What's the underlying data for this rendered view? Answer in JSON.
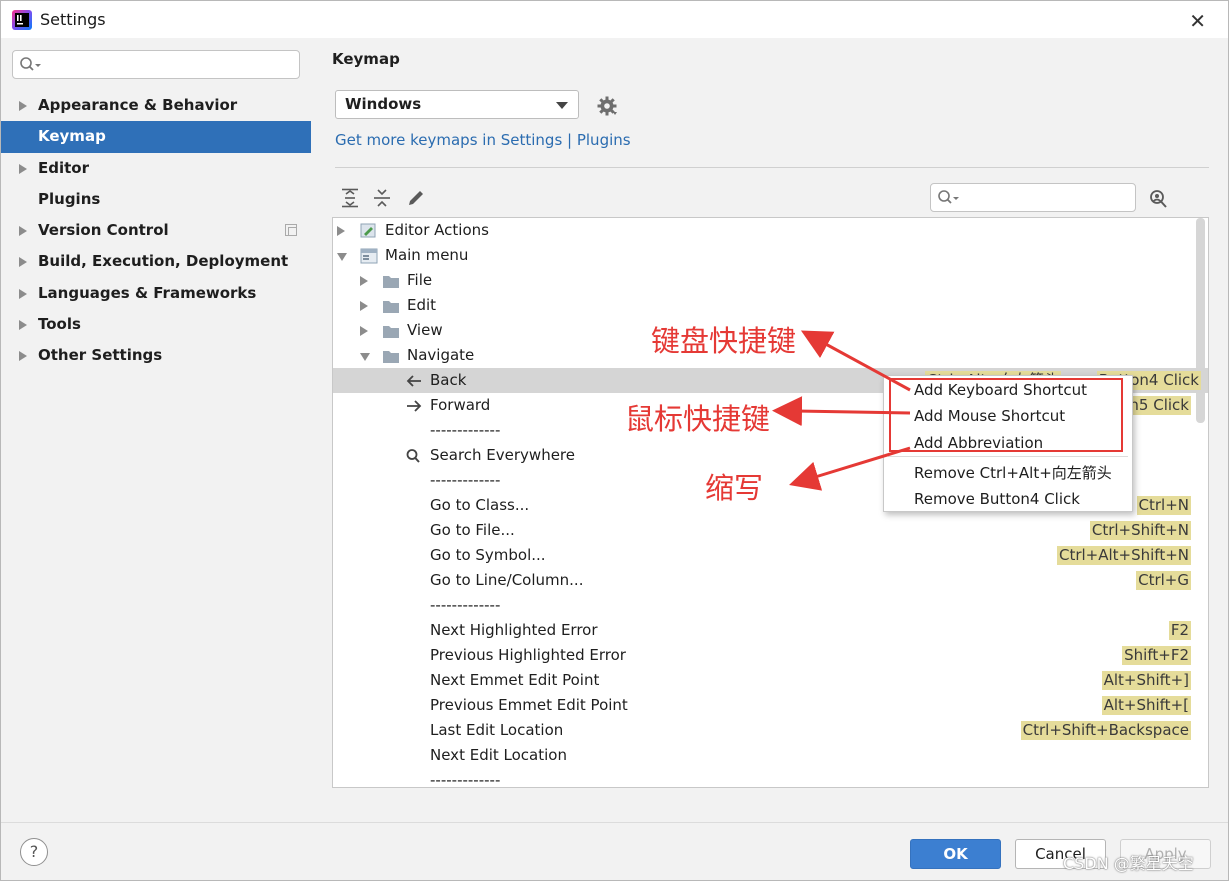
{
  "window": {
    "title": "Settings",
    "close_glyph": "✕"
  },
  "sidebar": {
    "search_placeholder": "",
    "items": [
      {
        "label": "Appearance & Behavior",
        "expandable": true
      },
      {
        "label": "Keymap",
        "expandable": false,
        "selected": true
      },
      {
        "label": "Editor",
        "expandable": true
      },
      {
        "label": "Plugins",
        "expandable": false
      },
      {
        "label": "Version Control",
        "expandable": true
      },
      {
        "label": "Build, Execution, Deployment",
        "expandable": true
      },
      {
        "label": "Languages & Frameworks",
        "expandable": true
      },
      {
        "label": "Tools",
        "expandable": true
      },
      {
        "label": "Other Settings",
        "expandable": true
      }
    ]
  },
  "main": {
    "title": "Keymap",
    "keymap_value": "Windows",
    "more_keymaps_link": "Get more keymaps in Settings | Plugins",
    "filter_placeholder": ""
  },
  "tree": [
    {
      "label": "Editor Actions",
      "indent": 0,
      "toggle": "right",
      "icon": "editor-actions-icon"
    },
    {
      "label": "Main menu",
      "indent": 0,
      "toggle": "down",
      "icon": "main-menu-icon"
    },
    {
      "label": "File",
      "indent": 1,
      "toggle": "right",
      "icon": "folder-icon"
    },
    {
      "label": "Edit",
      "indent": 1,
      "toggle": "right",
      "icon": "folder-icon"
    },
    {
      "label": "View",
      "indent": 1,
      "toggle": "right",
      "icon": "folder-icon"
    },
    {
      "label": "Navigate",
      "indent": 1,
      "toggle": "down",
      "icon": "folder-icon"
    },
    {
      "label": "Back",
      "indent": 2,
      "icon": "arrow-left-icon",
      "selected": true,
      "shortcuts": [
        "Ctrl+Alt+向左箭头",
        "Button4 Click"
      ]
    },
    {
      "label": "Forward",
      "indent": 2,
      "icon": "arrow-right-icon",
      "shortcuts": [
        "Button5 Click"
      ]
    },
    {
      "label": "-------------",
      "indent": 2
    },
    {
      "label": "Search Everywhere",
      "indent": 2,
      "icon": "search-icon"
    },
    {
      "label": "-------------",
      "indent": 2
    },
    {
      "label": "Go to Class...",
      "indent": 2,
      "shortcuts": [
        "Ctrl+N"
      ]
    },
    {
      "label": "Go to File...",
      "indent": 2,
      "shortcuts": [
        "Ctrl+Shift+N"
      ]
    },
    {
      "label": "Go to Symbol...",
      "indent": 2,
      "shortcuts": [
        "Ctrl+Alt+Shift+N"
      ]
    },
    {
      "label": "Go to Line/Column...",
      "indent": 2,
      "shortcuts": [
        "Ctrl+G"
      ]
    },
    {
      "label": "-------------",
      "indent": 2
    },
    {
      "label": "Next Highlighted Error",
      "indent": 2,
      "shortcuts": [
        "F2"
      ]
    },
    {
      "label": "Previous Highlighted Error",
      "indent": 2,
      "shortcuts": [
        "Shift+F2"
      ]
    },
    {
      "label": "Next Emmet Edit Point",
      "indent": 2,
      "shortcuts": [
        "Alt+Shift+]"
      ]
    },
    {
      "label": "Previous Emmet Edit Point",
      "indent": 2,
      "shortcuts": [
        "Alt+Shift+["
      ]
    },
    {
      "label": "Last Edit Location",
      "indent": 2,
      "shortcuts": [
        "Ctrl+Shift+Backspace"
      ]
    },
    {
      "label": "Next Edit Location",
      "indent": 2
    },
    {
      "label": "-------------",
      "indent": 2
    }
  ],
  "context_menu": [
    "Add Keyboard Shortcut",
    "Add Mouse Shortcut",
    "Add Abbreviation",
    "Remove Ctrl+Alt+向左箭头",
    "Remove Button4 Click"
  ],
  "annotations": {
    "keyboard": "键盘快捷键",
    "mouse": "鼠标快捷键",
    "abbreviation": "缩写"
  },
  "buttons": {
    "help": "?",
    "ok": "OK",
    "cancel": "Cancel",
    "apply": "Apply"
  },
  "watermark": "CSDN @繁星夭空",
  "colors": {
    "accent": "#2f70b8",
    "shortcut_bg": "#e5dc9a",
    "annotation": "#e53935",
    "link": "#2b6cb0"
  }
}
